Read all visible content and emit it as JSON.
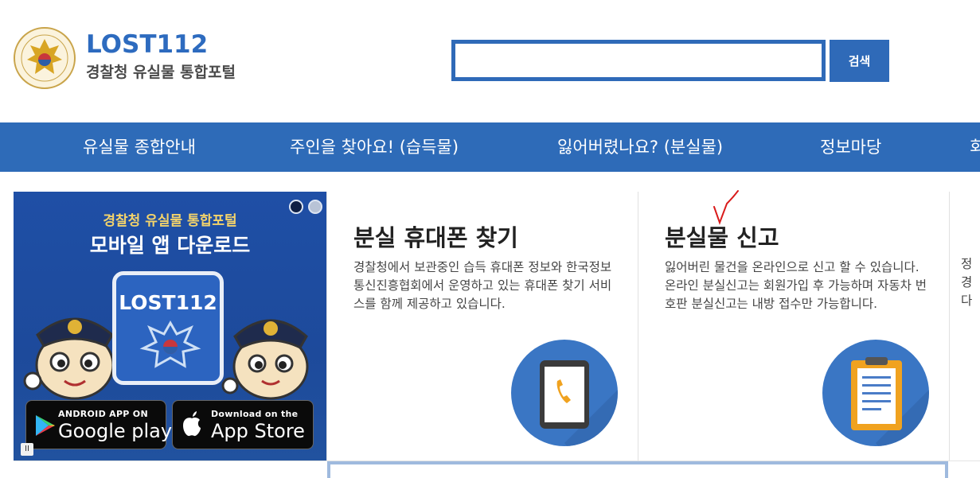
{
  "header": {
    "logo_title": "LOST112",
    "logo_subtitle": "경찰청 유실물 통합포털",
    "search": {
      "value": "",
      "placeholder": ""
    },
    "search_button": "검색"
  },
  "nav": {
    "items": [
      {
        "label": "유실물 종합안내"
      },
      {
        "label": "주인을 찾아요! (습득물)"
      },
      {
        "label": "잃어버렸나요? (분실물)"
      },
      {
        "label": "정보마당"
      },
      {
        "label": "회"
      }
    ]
  },
  "banner": {
    "line1": "경찰청 유실물 통합포털",
    "line2": "모바일 앱 다운로드",
    "app_name": "LOST112",
    "google_small": "ANDROID APP ON",
    "google_big": "Google play",
    "apple_small": "Download on the",
    "apple_big": "App Store",
    "pause": "II"
  },
  "cards": [
    {
      "title": "분실 휴대폰 찾기",
      "description": "경찰청에서 보관중인 습득 휴대폰 정보와 한국정보통신진흥협회에서 운영하고 있는 휴대폰 찾기 서비스를 함께 제공하고 있습니다.",
      "icon": "phone-icon"
    },
    {
      "title": "분실물 신고",
      "description": "잃어버린 물건을 온라인으로 신고 할 수 있습니다. 온라인 분실신고는 회원가입 후 가능하며 자동차 번호판 분실신고는 내방 접수만 가능합니다.",
      "icon": "clipboard-icon"
    }
  ],
  "card3_partial": [
    "정",
    "경",
    "다"
  ],
  "colors": {
    "brand_blue": "#2e6bb8",
    "gold": "#f3d36b",
    "circle_blue": "#3a76c4"
  }
}
